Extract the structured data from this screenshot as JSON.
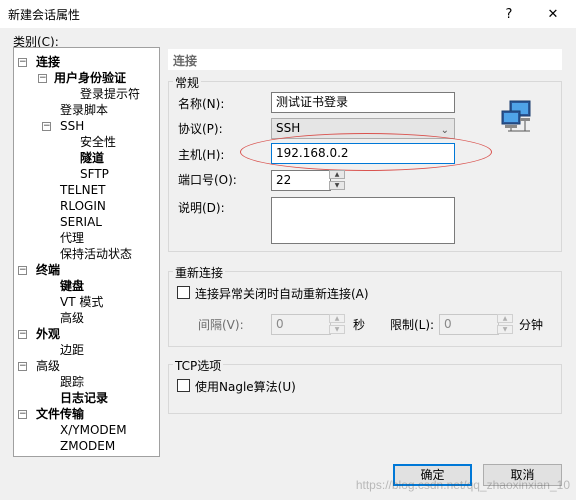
{
  "window": {
    "title": "新建会话属性",
    "help_icon": "?",
    "close_icon": "✕"
  },
  "category_label": "类别(C):",
  "tree": [
    {
      "name": "tree-item-connection",
      "label": "连接",
      "bold": true,
      "expander": "−"
    },
    {
      "name": "tree-item-user-auth",
      "label": "用户身份验证",
      "bold": true,
      "expander": "−"
    },
    {
      "name": "tree-item-login-prompts",
      "label": "登录提示符",
      "bold": false
    },
    {
      "name": "tree-item-login-script",
      "label": "登录脚本",
      "bold": false
    },
    {
      "name": "tree-item-ssh",
      "label": "SSH",
      "bold": false,
      "expander": "−"
    },
    {
      "name": "tree-item-security",
      "label": "安全性",
      "bold": false
    },
    {
      "name": "tree-item-tunneling",
      "label": "隧道",
      "bold": true
    },
    {
      "name": "tree-item-sftp",
      "label": "SFTP",
      "bold": false
    },
    {
      "name": "tree-item-telnet",
      "label": "TELNET",
      "bold": false
    },
    {
      "name": "tree-item-rlogin",
      "label": "RLOGIN",
      "bold": false
    },
    {
      "name": "tree-item-serial",
      "label": "SERIAL",
      "bold": false
    },
    {
      "name": "tree-item-proxy",
      "label": "代理",
      "bold": false
    },
    {
      "name": "tree-item-keep-alive",
      "label": "保持活动状态",
      "bold": false
    },
    {
      "name": "tree-item-terminal",
      "label": "终端",
      "bold": true,
      "expander": "−"
    },
    {
      "name": "tree-item-keyboard",
      "label": "键盘",
      "bold": true
    },
    {
      "name": "tree-item-vt-mode",
      "label": "VT 模式",
      "bold": false
    },
    {
      "name": "tree-item-terminal-advanced",
      "label": "高级",
      "bold": false
    },
    {
      "name": "tree-item-appearance",
      "label": "外观",
      "bold": true,
      "expander": "−"
    },
    {
      "name": "tree-item-margin",
      "label": "边距",
      "bold": false
    },
    {
      "name": "tree-item-advanced",
      "label": "高级",
      "bold": false,
      "expander": "−"
    },
    {
      "name": "tree-item-trace",
      "label": "跟踪",
      "bold": false
    },
    {
      "name": "tree-item-logging",
      "label": "日志记录",
      "bold": true
    },
    {
      "name": "tree-item-file-transfer",
      "label": "文件传输",
      "bold": true,
      "expander": "−"
    },
    {
      "name": "tree-item-xymodem",
      "label": "X/YMODEM",
      "bold": false
    },
    {
      "name": "tree-item-zmodem",
      "label": "ZMODEM",
      "bold": false
    }
  ],
  "panel": {
    "header": "连接",
    "general": {
      "legend": "常规",
      "name_label": "名称(N):",
      "name_value": "测试证书登录",
      "protocol_label": "协议(P):",
      "protocol_value": "SSH",
      "host_label": "主机(H):",
      "host_value": "192.168.0.2",
      "port_label": "端口号(O):",
      "port_value": "22",
      "desc_label": "说明(D):",
      "desc_value": ""
    },
    "reconnect": {
      "legend": "重新连接",
      "checkbox_label": "连接异常关闭时自动重新连接(A)",
      "interval_label": "间隔(V):",
      "interval_value": "0",
      "interval_unit": "秒",
      "limit_label": "限制(L):",
      "limit_value": "0",
      "limit_unit": "分钟"
    },
    "tcp": {
      "legend": "TCP选项",
      "nagle_label": "使用Nagle算法(U)"
    }
  },
  "buttons": {
    "ok": "确定",
    "cancel": "取消"
  },
  "watermark": "https://blog.csdn.net/qq_zhaoxinxian_10",
  "colors": {
    "accent": "#0078d7",
    "highlight_oval": "#d9534f"
  }
}
